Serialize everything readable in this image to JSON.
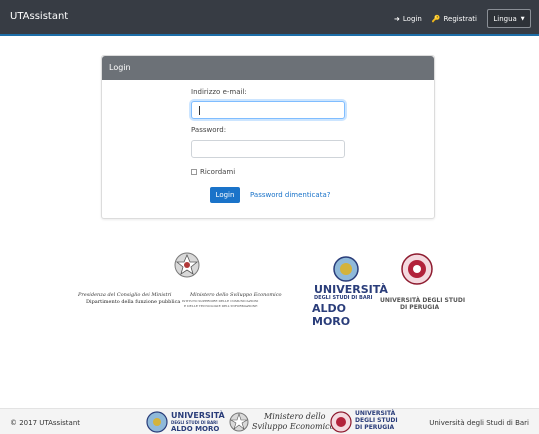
{
  "navbar": {
    "brand": "UTAssistant",
    "login_label": "Login",
    "register_label": "Registrati",
    "language_label": "Lingua"
  },
  "login_card": {
    "header": "Login",
    "email_label": "Indirizzo e-mail:",
    "email_value": "",
    "password_label": "Password:",
    "password_value": "",
    "remember_label": "Ricordami",
    "submit_label": "Login",
    "forgot_label": "Password dimenticata?"
  },
  "logos": {
    "presidenza_line1": "Presidenza del Consiglio dei Ministri",
    "presidenza_line2": "Dipartimento della funzione pubblica",
    "mise_line1": "Ministero dello Sviluppo Economico",
    "mise_line2": "ISTITUTO SUPERIORE DELLE COMUNICAZIONI",
    "mise_line3": "E DELLE TECNOLOGIE DELL'INFORMAZIONE",
    "uniba_line1": "UNIVERSITÀ",
    "uniba_line2": "DEGLI STUDI DI BARI",
    "uniba_line3": "ALDO MORO",
    "unipg_line1": "UNIVERSITÀ DEGLI STUDI",
    "unipg_line2": "DI PERUGIA"
  },
  "footer": {
    "copyright": "© 2017 UTAssistant",
    "uniba_line1": "UNIVERSITÀ",
    "uniba_line2": "DEGLI STUDI DI BARI",
    "uniba_line3": "ALDO MORO",
    "mise_line1": "Ministero dello",
    "mise_line2": "Sviluppo Economico",
    "unipg_line1": "UNIVERSITÀ",
    "unipg_line2": "DEGLI STUDI",
    "unipg_line3": "DI PERUGIA",
    "right_text": "Università degli Studi di Bari"
  }
}
